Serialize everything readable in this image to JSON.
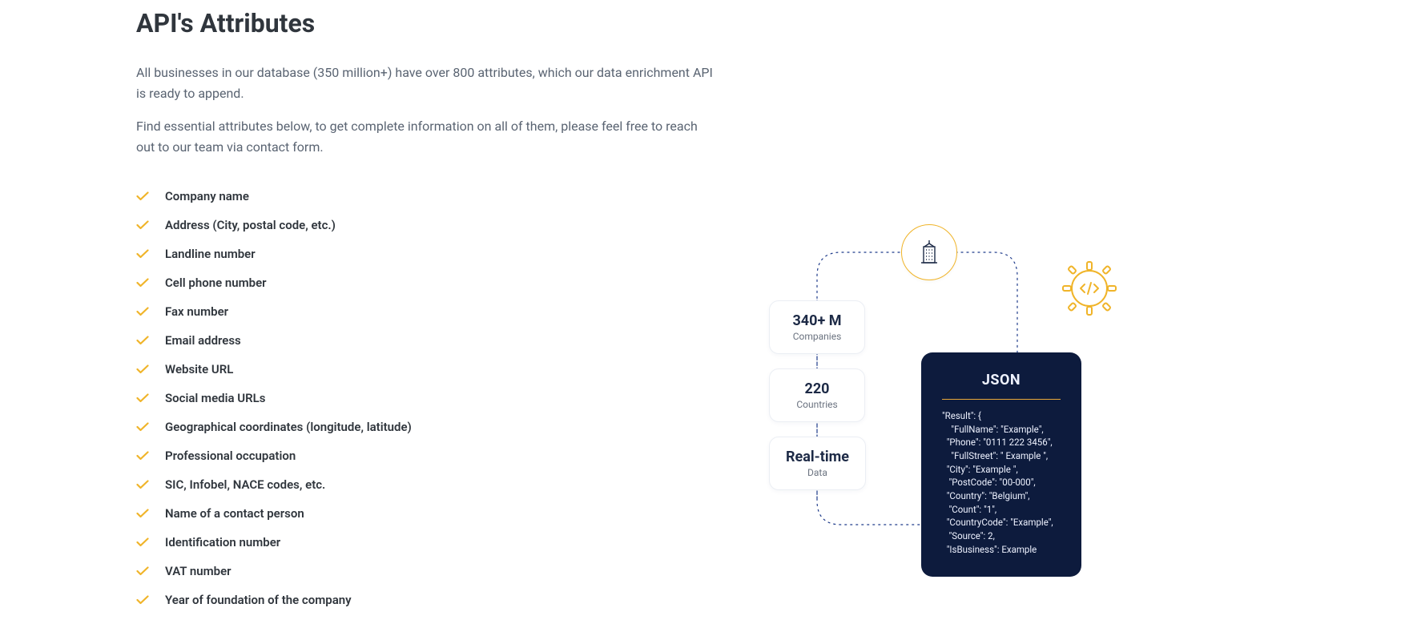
{
  "heading": "API's Attributes",
  "intro1": "All businesses in our database (350 million+) have over 800 attributes, which our data enrichment API is ready to append.",
  "intro2": "Find essential attributes below, to get complete information on all of them, please feel free to reach out to our team via contact form.",
  "attributes": [
    "Company name",
    "Address (City, postal code, etc.)",
    "Landline number",
    "Cell phone number",
    "Fax number",
    "Email address",
    "Website URL",
    "Social media URLs",
    "Geographical coordinates (longitude, latitude)",
    "Professional occupation",
    "SIC, Infobel, NACE codes, etc.",
    "Name of a contact person",
    "Identification number",
    "VAT number",
    "Year of foundation of the company"
  ],
  "diagram": {
    "stat1": {
      "big": "340+ M",
      "small": "Companies"
    },
    "stat2": {
      "big": "220",
      "small": "Countries"
    },
    "stat3": {
      "big": "Real-time",
      "small": "Data"
    },
    "json_header": "JSON",
    "json_body": "\"Result\": {\n    \"FullName\": \"Example\",\n  \"Phone\": \"0111 222 3456\",\n    \"FullStreet\": \" Example \",\n  \"City\": \"Example \",\n   \"PostCode\": \"00-000\",\n  \"Country\": \"Belgium\",\n   \"Count\": \"1\",\n  \"CountryCode\": \"Example\",\n   \"Source\": 2,\n  \"IsBusiness\": Example"
  }
}
